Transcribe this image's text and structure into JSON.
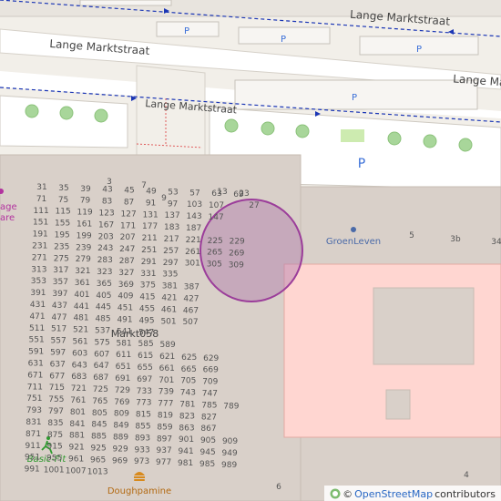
{
  "map": {
    "streets": [
      "Lange Marktstraat",
      "Lange Marktstraat",
      "Lange Marktstraat",
      "Lange Ma"
    ],
    "parking_label": "P",
    "pois": [
      {
        "name": "GroenLeven",
        "icon": "poi-dot-icon"
      },
      {
        "name": "Markt058",
        "icon": ""
      },
      {
        "name": "Basic-Fit",
        "icon": "fitness-runner-icon"
      },
      {
        "name": "Doughpamine",
        "icon": "fastfood-burger-icon"
      },
      {
        "name": "age",
        "icon": "poi-dot-icon"
      },
      {
        "name": "are",
        "icon": ""
      }
    ],
    "house_numbers": {
      "row": [
        "3",
        "7",
        "9",
        "13",
        "23",
        "27",
        "5",
        "3b",
        "34",
        "6",
        "4"
      ],
      "grid": [
        "31 35 39 43 45 49 53 57 63 69",
        "71 75 79 83 87 91 97 103 107",
        "111 115 119 123 127 131 137 143 147",
        "151 155 161 167 171 177 183 187",
        "191 195 199 203 207 211 217 221 225 229",
        "231 235 239 243 247 251 257 261 265 269",
        "271 275 279 283 287 291 297 301 305 309",
        "313 317 321 323 327 331 335",
        "353 357 361 365 369 375 381 387",
        "391 397 401 405 409 415 421 427",
        "431 437 441 445 451 455 461 467",
        "471 477 481 485 491 495 501 507",
        "511 517 521 537 541 547",
        "551 557 561 575 581 585 589",
        "591 597 603 607 611 615 621 625 629",
        "631 637 643 647 651 655 661 665 669",
        "671 677 683 687 691 697 701 705 709",
        "711 715 721 725 729 733 739 743 747",
        "751 755 761 765 769 773 777 781 785 789",
        "793 797 801 805 809 815 819 823 827",
        "831 835 841 845 849 855 859 863 867",
        "871 875 881 885 889 893 897 901 905 909",
        "911 915 921 925 929 933 937 941 945 949",
        "951 955 961 965 969 973 977 981 985 989",
        "991 1001 1007 1013"
      ]
    },
    "colors": {
      "background": "#f2efe9",
      "road": "#ffffff",
      "building": "#d9d0c9",
      "pedestrian": "#e5e2dd",
      "retail": "#ffd6d1",
      "parking_label": "#3a6fd8",
      "highlight_fill": "#b07bab",
      "highlight_stroke": "#9b3d9a",
      "bus_route": "#1b36b5",
      "tree": "#a8d69a"
    }
  },
  "attribution": {
    "icon": "osm-logo-icon",
    "link_text": "OpenStreetMap",
    "suffix": "contributors",
    "prefix": "©"
  }
}
